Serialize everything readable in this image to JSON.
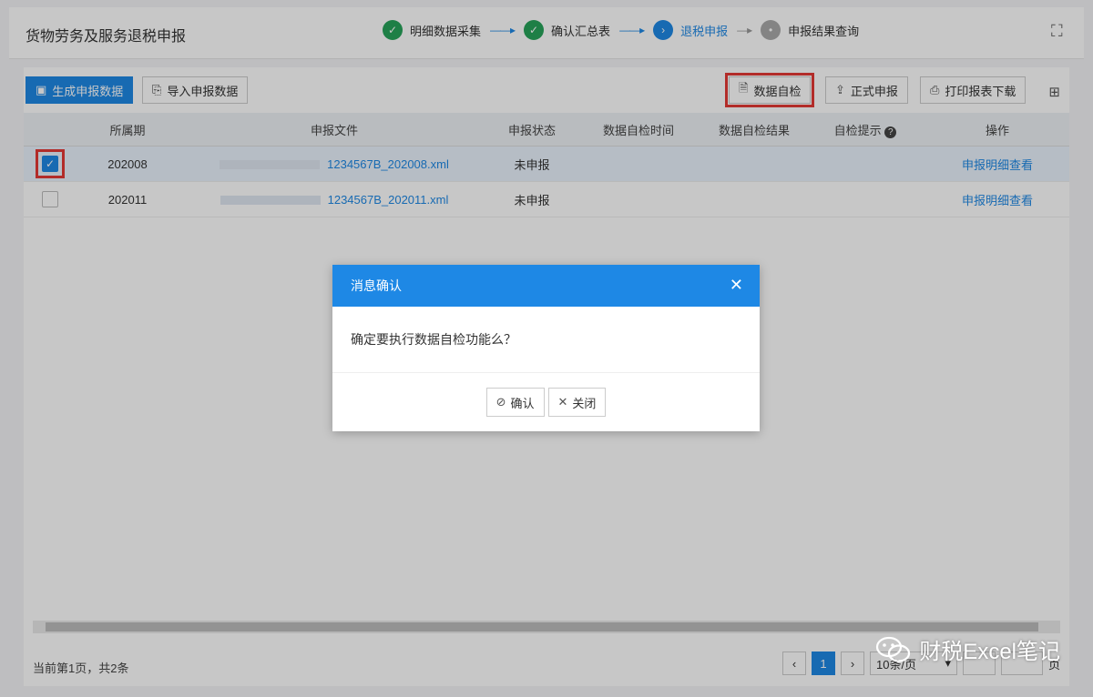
{
  "header": {
    "title": "货物劳务及服务退税申报",
    "steps": [
      {
        "label": "明细数据采集",
        "state": "done"
      },
      {
        "label": "确认汇总表",
        "state": "done"
      },
      {
        "label": "退税申报",
        "state": "active"
      },
      {
        "label": "申报结果查询",
        "state": "todo"
      }
    ]
  },
  "toolbar": {
    "tab_generate": "生成申报数据",
    "tab_import": "导入申报数据",
    "btn_self_check": "数据自检",
    "btn_formal_declare": "正式申报",
    "btn_print": "打印报表下载"
  },
  "table": {
    "columns": [
      "所属期",
      "申报文件",
      "申报状态",
      "数据自检时间",
      "数据自检结果",
      "自检提示",
      "操作"
    ],
    "rows": [
      {
        "period": "202008",
        "file": "1234567B_202008.xml",
        "status": "未申报",
        "action": "申报明细查看",
        "checked": true
      },
      {
        "period": "202011",
        "file": "1234567B_202011.xml",
        "status": "未申报",
        "action": "申报明细查看",
        "checked": false
      }
    ]
  },
  "footer": {
    "summary": "当前第1页，共2条",
    "current_page": "1",
    "page_size": "10条/页",
    "page_unit": "页"
  },
  "dialog": {
    "title": "消息确认",
    "message": "确定要执行数据自检功能么？",
    "confirm": "确认",
    "close": "关闭"
  },
  "watermark": {
    "text": "财税Excel笔记"
  },
  "colors": {
    "primary": "#1e88e5",
    "success": "#27a35a",
    "highlight": "#e53935"
  }
}
